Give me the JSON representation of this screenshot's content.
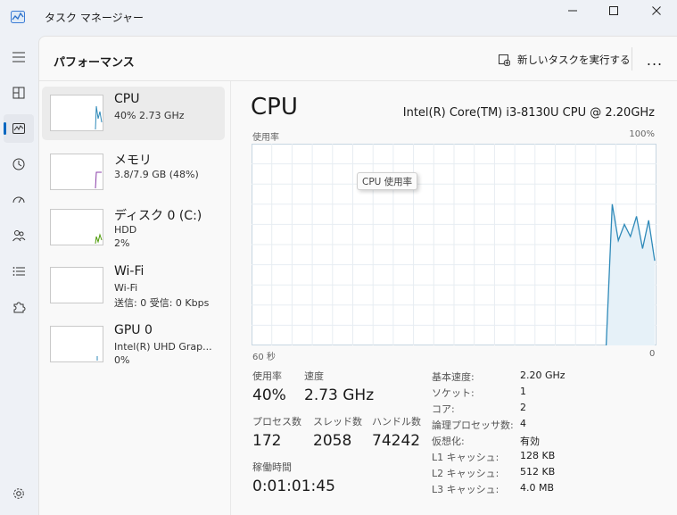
{
  "window": {
    "title": "タスク マネージャー"
  },
  "colors": {
    "accent": "#0067c0",
    "cpu_line": "#2f8ab9",
    "memory_line": "#8a3ea8",
    "disk_line": "#4d9a06"
  },
  "header": {
    "title": "パフォーマンス",
    "new_task": "新しいタスクを実行する",
    "more": "..."
  },
  "devices": [
    {
      "name": "CPU",
      "sub1": "40%  2.73 GHz",
      "sub2": ""
    },
    {
      "name": "メモリ",
      "sub1": "3.8/7.9 GB (48%)",
      "sub2": ""
    },
    {
      "name": "ディスク 0 (C:)",
      "sub1": "HDD",
      "sub2": "2%"
    },
    {
      "name": "Wi-Fi",
      "sub1": "Wi-Fi",
      "sub2": "送信: 0  受信: 0 Kbps"
    },
    {
      "name": "GPU 0",
      "sub1": "Intel(R) UHD Grap...",
      "sub2": "0%"
    }
  ],
  "main": {
    "title": "CPU",
    "model": "Intel(R) Core(TM) i3-8130U CPU @ 2.20GHz",
    "graph_label": "使用率",
    "graph_max": "100%",
    "time_left": "60 秒",
    "time_right": "0",
    "tooltip": "CPU 使用率",
    "stats": {
      "util_label": "使用率",
      "util_value": "40%",
      "speed_label": "速度",
      "speed_value": "2.73 GHz",
      "proc_label": "プロセス数",
      "proc_value": "172",
      "thread_label": "スレッド数",
      "thread_value": "2058",
      "handle_label": "ハンドル数",
      "handle_value": "74242",
      "uptime_label": "稼働時間",
      "uptime_value": "0:01:01:45"
    },
    "specs": [
      {
        "key": "基本速度:",
        "value": "2.20 GHz"
      },
      {
        "key": "ソケット:",
        "value": "1"
      },
      {
        "key": "コア:",
        "value": "2"
      },
      {
        "key": "論理プロセッサ数:",
        "value": "4"
      },
      {
        "key": "仮想化:",
        "value": "有効"
      },
      {
        "key": "L1 キャッシュ:",
        "value": "128 KB"
      },
      {
        "key": "L2 キャッシュ:",
        "value": "512 KB"
      },
      {
        "key": "L3 キャッシュ:",
        "value": "4.0 MB"
      }
    ]
  },
  "cpu_usage_series": [
    0,
    70,
    52,
    60,
    54,
    64,
    48,
    62,
    42
  ]
}
